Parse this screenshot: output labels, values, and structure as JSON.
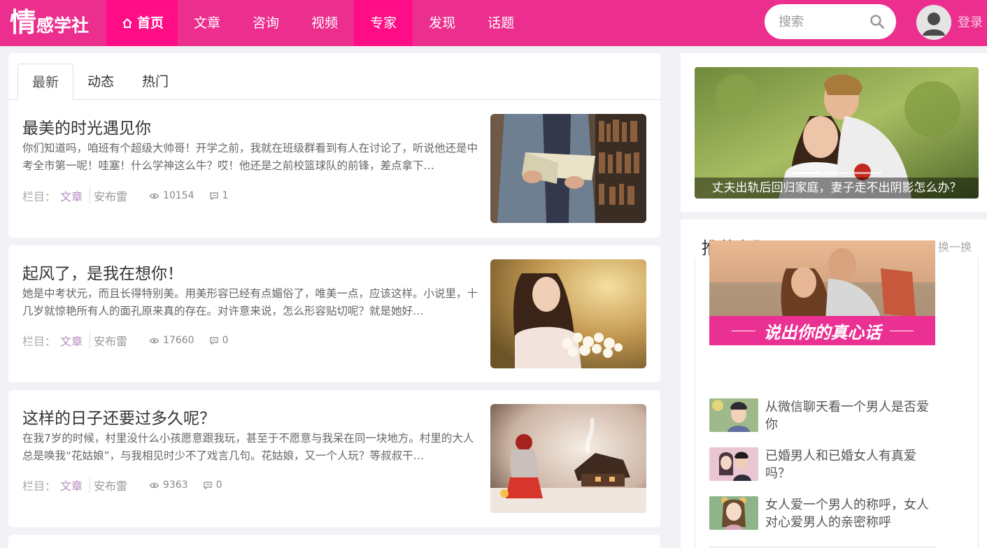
{
  "header": {
    "logo_big": "情",
    "logo_rest": "感学社",
    "nav": [
      {
        "label": "首页"
      },
      {
        "label": "文章"
      },
      {
        "label": "咨询"
      },
      {
        "label": "视频"
      },
      {
        "label": "专家"
      },
      {
        "label": "发现"
      },
      {
        "label": "话题"
      }
    ],
    "search_placeholder": "搜索",
    "login_label": "登录"
  },
  "tabs": [
    "最新",
    "动态",
    "热门"
  ],
  "articles": [
    {
      "title": "最美的时光遇见你",
      "excerpt": "你们知道吗，咱班有个超级大帅哥！开学之前，我就在班级群看到有人在讨论了，听说他还是中考全市第一呢！哇塞！什么学神这么牛？哎！他还是之前校篮球队的前锋，差点拿下…",
      "category_label": "栏目：",
      "category": "文章",
      "author": "安布雷",
      "views": "10154",
      "comments": "1"
    },
    {
      "title": "起风了，是我在想你！",
      "excerpt": "她是中考状元，而且长得特别美。用美形容已经有点媚俗了，唯美一点，应该这样。小说里，十几岁就惊艳所有人的面孔原来真的存在。对许意来说，怎么形容贴切呢？就是她好…",
      "category_label": "栏目：",
      "category": "文章",
      "author": "安布雷",
      "views": "17660",
      "comments": "0"
    },
    {
      "title": "这样的日子还要过多久呢？",
      "excerpt": "在我7岁的时候，村里没什么小孩愿意跟我玩，甚至于不愿意与我呆在同一块地方。村里的大人总是唤我“花姑娘”，与我相见时少不了戏言几句。花姑娘，又一个人玩？等叔叔干…",
      "category_label": "栏目：",
      "category": "文章",
      "author": "安布雷",
      "views": "9363",
      "comments": "0"
    }
  ],
  "slider": {
    "caption": "丈夫出轨后回归家庭，妻子走不出阴影怎么办？"
  },
  "topics": {
    "heading": "推荐专题",
    "refresh_label": "换一换",
    "banner_text": "说出你的真心话",
    "items": [
      {
        "title": "从微信聊天看一个男人是否爱你"
      },
      {
        "title": "已婚男人和已婚女人有真爱吗？"
      },
      {
        "title": "女人爱一个男人的称呼，女人对心爱男人的亲密称呼"
      }
    ]
  },
  "colors": {
    "brand": "#ec2e8e",
    "nav_active": "#ff0d87",
    "category": "#b48cc0"
  }
}
